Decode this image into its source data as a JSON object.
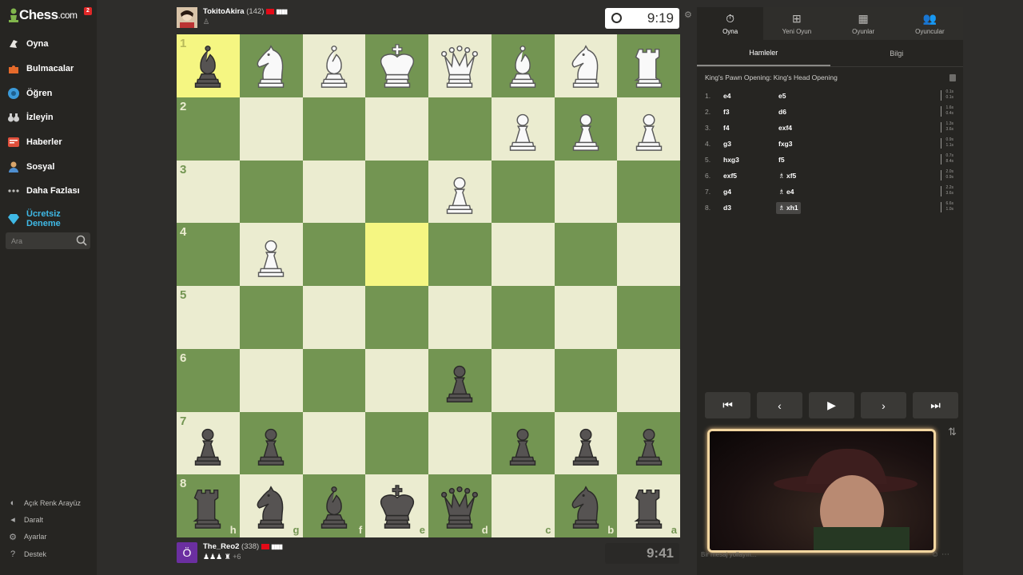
{
  "sidebar": {
    "logo_text": "Chess",
    "logo_domain": ".com",
    "notification_count": "2",
    "items": [
      {
        "label": "Oyna",
        "icon": "play-hand-icon",
        "color": "#e8e6e1"
      },
      {
        "label": "Bulmacalar",
        "icon": "puzzle-icon",
        "color": "#e56a2b"
      },
      {
        "label": "Öğren",
        "icon": "learn-icon",
        "color": "#3b9ad9"
      },
      {
        "label": "İzleyin",
        "icon": "binoculars-icon",
        "color": "#cfcfcf"
      },
      {
        "label": "Haberler",
        "icon": "news-icon",
        "color": "#e0503c"
      },
      {
        "label": "Sosyal",
        "icon": "social-icon",
        "color": "#d9a56a"
      },
      {
        "label": "Daha Fazlası",
        "icon": "more-icon",
        "color": "#bdbcb9"
      }
    ],
    "trial": {
      "label_line1": "Ücretsiz",
      "label_line2": "Deneme",
      "icon": "diamond-icon"
    },
    "search_placeholder": "Ara",
    "bottom": [
      {
        "label": "Açık Renk Arayüz",
        "icon": "theme-icon"
      },
      {
        "label": "Daralt",
        "icon": "collapse-icon"
      },
      {
        "label": "Ayarlar",
        "icon": "settings-icon"
      },
      {
        "label": "Destek",
        "icon": "help-icon"
      }
    ]
  },
  "players": {
    "top": {
      "name": "TokitoAkira",
      "rating": "(142)",
      "clock": "9:19"
    },
    "bottom": {
      "name": "The_Reo2",
      "rating": "(338)",
      "avatar_letter": "Ö",
      "captured_extra": "+6",
      "clock": "9:41"
    }
  },
  "board": {
    "ranks": [
      "1",
      "2",
      "3",
      "4",
      "5",
      "6",
      "7",
      "8"
    ],
    "files": [
      "h",
      "g",
      "f",
      "e",
      "d",
      "c",
      "b",
      "a"
    ],
    "highlight_squares": [
      "h1",
      "e4"
    ],
    "pieces": [
      {
        "sq": "h1",
        "p": "bB"
      },
      {
        "sq": "g1",
        "p": "wN"
      },
      {
        "sq": "f1",
        "p": "wB"
      },
      {
        "sq": "e1",
        "p": "wK"
      },
      {
        "sq": "d1",
        "p": "wQ"
      },
      {
        "sq": "c1",
        "p": "wB"
      },
      {
        "sq": "b1",
        "p": "wN"
      },
      {
        "sq": "a1",
        "p": "wR"
      },
      {
        "sq": "c2",
        "p": "wP"
      },
      {
        "sq": "b2",
        "p": "wP"
      },
      {
        "sq": "a2",
        "p": "wP"
      },
      {
        "sq": "d3",
        "p": "wP"
      },
      {
        "sq": "g4",
        "p": "wP"
      },
      {
        "sq": "d6",
        "p": "bP"
      },
      {
        "sq": "h7",
        "p": "bP"
      },
      {
        "sq": "g7",
        "p": "bP"
      },
      {
        "sq": "c7",
        "p": "bP"
      },
      {
        "sq": "b7",
        "p": "bP"
      },
      {
        "sq": "a7",
        "p": "bP"
      },
      {
        "sq": "h8",
        "p": "bR"
      },
      {
        "sq": "g8",
        "p": "bN"
      },
      {
        "sq": "f8",
        "p": "bB"
      },
      {
        "sq": "e8",
        "p": "bK"
      },
      {
        "sq": "d8",
        "p": "bQ"
      },
      {
        "sq": "b8",
        "p": "bN"
      },
      {
        "sq": "a8",
        "p": "bR"
      }
    ]
  },
  "panel": {
    "tabs": [
      {
        "label": "Oyna",
        "icon": "stopwatch-icon"
      },
      {
        "label": "Yeni Oyun",
        "icon": "plus-icon"
      },
      {
        "label": "Oyunlar",
        "icon": "board-icon"
      },
      {
        "label": "Oyuncular",
        "icon": "players-icon"
      }
    ],
    "subtabs": [
      "Hamleler",
      "Bilgi"
    ],
    "opening": "King's Pawn Opening: King's Head Opening",
    "moves": [
      {
        "n": "1.",
        "w": "e4",
        "b": "e5",
        "tw": "0.1s",
        "tb": "0.1s"
      },
      {
        "n": "2.",
        "w": "f3",
        "b": "d6",
        "tw": "1.6s",
        "tb": "0.4s"
      },
      {
        "n": "3.",
        "w": "f4",
        "b": "exf4",
        "tw": "1.3s",
        "tb": "3.6s"
      },
      {
        "n": "4.",
        "w": "g3",
        "b": "fxg3",
        "tw": "0.9s",
        "tb": "1.1s"
      },
      {
        "n": "5.",
        "w": "hxg3",
        "b": "f5",
        "tw": "0.7s",
        "tb": "8.4s"
      },
      {
        "n": "6.",
        "w": "exf5",
        "b": "xf5",
        "tw": "2.0s",
        "tb": "0.9s"
      },
      {
        "n": "7.",
        "w": "g4",
        "b": "e4",
        "tw": "2.2s",
        "tb": "3.6s"
      },
      {
        "n": "8.",
        "w": "d3",
        "b": "xh1",
        "tw": "6.6s",
        "tb": "1.0s"
      }
    ],
    "chat_placeholder": "Bir mesaj yollayın..."
  }
}
